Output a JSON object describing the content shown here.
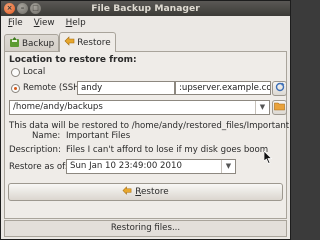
{
  "window": {
    "title": "File Backup Manager"
  },
  "menu": [
    {
      "label": "File",
      "mnemonic": "F"
    },
    {
      "label": "View",
      "mnemonic": "V"
    },
    {
      "label": "Help",
      "mnemonic": "H"
    }
  ],
  "tabs": [
    {
      "label": "Backup",
      "icon": "save-icon",
      "active": false
    },
    {
      "label": "Restore",
      "icon": "restore-arrow-icon",
      "active": true
    }
  ],
  "restore": {
    "location_heading": "Location to restore from:",
    "local_label": "Local",
    "remote_label": "Remote (SSH)",
    "selected_option": "remote",
    "ssh_user": "andy",
    "ssh_host": ":upserver.example.com",
    "path": "/home/andy/backups",
    "info_line": "This data will be restored to /home/andy/restored_files/Important Files",
    "name_label": "Name:",
    "name_value": "Important Files",
    "description_label": "Description:",
    "description_value": "Files I can't afford to lose if my disk goes boom",
    "restore_as_of_label": "Restore as of:",
    "restore_as_of_value": "Sun Jan 10 23:49:00 2010",
    "restore_button": "Restore",
    "restore_button_mnemonic": "R"
  },
  "status": {
    "progress_text": "Restoring files..."
  },
  "colors": {
    "accent": "#d45a1a",
    "titlebar": "#3c3b37",
    "window_bg": "#ebe8e4"
  }
}
